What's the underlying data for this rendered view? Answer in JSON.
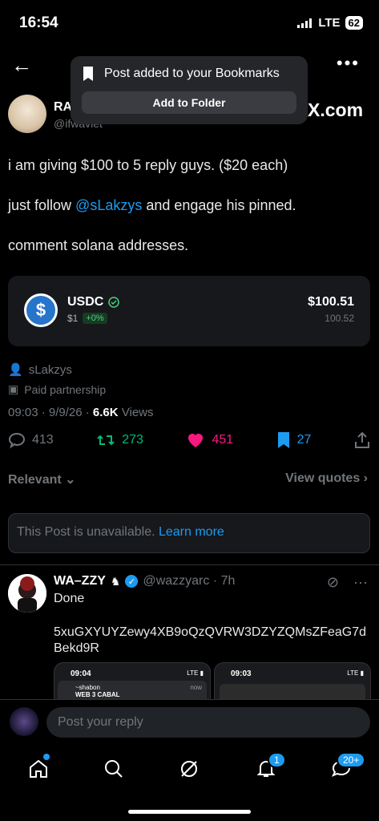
{
  "status": {
    "time": "16:54",
    "network": "LTE",
    "battery": "62"
  },
  "toast": {
    "message": "Post added to your Bookmarks",
    "button": "Add to Folder"
  },
  "author": {
    "name": "RA",
    "handle": "@ifwavlet",
    "link_domain": "X.com"
  },
  "post": {
    "line1": "i am giving $100 to 5 reply guys. ($20 each)",
    "line2_prefix": "just follow ",
    "line2_mention": "@sLakzys",
    "line2_suffix": " and engage his pinned.",
    "line3": "comment solana addresses."
  },
  "token": {
    "symbol": "USDC",
    "price": "$1",
    "change": "+0%",
    "value": "$100.51",
    "amount": "100.52",
    "coin_color": "#2775ca"
  },
  "meta": {
    "user": "sLakzys",
    "partnership": "Paid partnership",
    "timestamp": "09:03 · 9/9/26 · ",
    "views_count": "6.6K",
    "views_label": " Views"
  },
  "actions": {
    "replies": "413",
    "reposts": "273",
    "likes": "451",
    "bookmarks": "27"
  },
  "sort": {
    "relevant": "Relevant",
    "view_quotes": "View quotes"
  },
  "unavailable": {
    "text": "This Post is unavailable. ",
    "link": "Learn more"
  },
  "reply": {
    "name": "WA–ZZY",
    "handle": "@wazzyarc · 7h",
    "text": "Done",
    "address_line1": "5xuGXYUYZewy4XB9oQzQVRW3DZYZQMsZFeaG7d",
    "address_line2": "Bekd9R",
    "thumb1": {
      "time": "09:04",
      "sender": "~shabon",
      "group": "WEB 3 CABAL",
      "ago": "now"
    },
    "thumb2": {
      "time": "09:03"
    }
  },
  "composer": {
    "placeholder": "Post your reply"
  },
  "tabs": {
    "notifications_badge": "1",
    "messages_badge": "20+"
  },
  "colors": {
    "accent": "#1d9bf0",
    "like": "#f91880",
    "repost": "#00ba7c"
  }
}
